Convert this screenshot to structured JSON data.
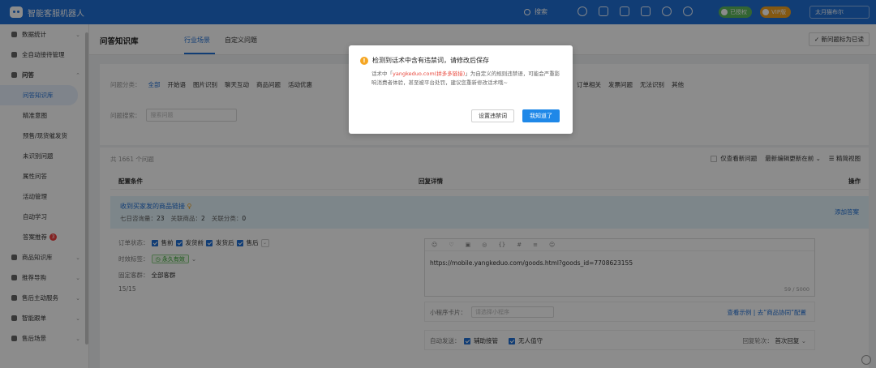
{
  "app": {
    "name": "智能客服机器人",
    "search_label": "搜索",
    "auth_badge": "已授权",
    "vip_badge": "VIP版",
    "user": "太月猫布尔"
  },
  "sidebar": {
    "items": [
      {
        "label": "数据统计"
      },
      {
        "label": "全自动接待管理"
      },
      {
        "label": "问答"
      },
      {
        "label": "问答知识库"
      },
      {
        "label": "精准意图"
      },
      {
        "label": "预售/现货催发货"
      },
      {
        "label": "未识别问题"
      },
      {
        "label": "属性问答"
      },
      {
        "label": "活动管理"
      },
      {
        "label": "自动学习"
      },
      {
        "label": "答案推荐",
        "badge": "3"
      },
      {
        "label": "商品知识库"
      },
      {
        "label": "推荐导购"
      },
      {
        "label": "售后主动服务"
      },
      {
        "label": "智能跟单"
      },
      {
        "label": "售后场景"
      }
    ]
  },
  "header": {
    "title": "问答知识库",
    "tabs": [
      "行业场景",
      "自定义问题"
    ],
    "right_button": "新问题标为已读"
  },
  "filter": {
    "category_label": "问题分类：",
    "categories_left": [
      "全部",
      "开始语",
      "图片识别",
      "聊天互动",
      "商品问题",
      "活动优惠"
    ],
    "categories_right": [
      "订单相关",
      "发票问题",
      "无法识别",
      "其他"
    ],
    "search_label": "问题搜索：",
    "search_placeholder": "搜索问题"
  },
  "list": {
    "total": "共 1661 个问题",
    "only_new": "仅查看新问题",
    "sort": "最新编辑更新在前",
    "simple_view": "精简视图",
    "columns": {
      "config": "配置条件",
      "answer": "回复详情",
      "op": "操作"
    },
    "question": {
      "title": "收到买家发的商品链接",
      "stat1_label": "七日咨询量：",
      "stat1": "23",
      "stat2_label": "关联商品：",
      "stat2": "2",
      "stat3_label": "关联分类：",
      "stat3": "0",
      "add_answer": "添加答案"
    },
    "conditions": {
      "order_label": "订单状态：",
      "order_states": [
        "售前",
        "发货前",
        "发货后",
        "售后"
      ],
      "time_label": "时效标签：",
      "time_tag": "永久有效",
      "fixed_label": "固定客群：",
      "fixed_value": "全部客群",
      "count": "15/15"
    },
    "editor": {
      "text": "https://mobile.yangkeduo.com/goods.html?goods_id=7708623155",
      "count": "59 / 5000"
    },
    "mini": {
      "label": "小程序卡片：",
      "placeholder": "请选择小程序",
      "link1": "查看示例",
      "link2": "去“商品协同”配置"
    },
    "auto": {
      "label": "自动发送：",
      "opt1": "辅助接管",
      "opt2": "无人值守",
      "mode_label": "回复轮次：",
      "mode_value": "首次回复"
    }
  },
  "modal": {
    "title": "检测到话术中含有违禁词，请修改后保存",
    "body_prefix": "话术中「",
    "body_word": "yangkeduo.com(拼多多链接)",
    "body_suffix": "」为自定义的规则违禁语，可能会严重影响消费者体验，甚至被平台处罚，建议您重新修改话术哦~",
    "btn_set": "设置违禁词",
    "btn_ok": "我知道了"
  }
}
